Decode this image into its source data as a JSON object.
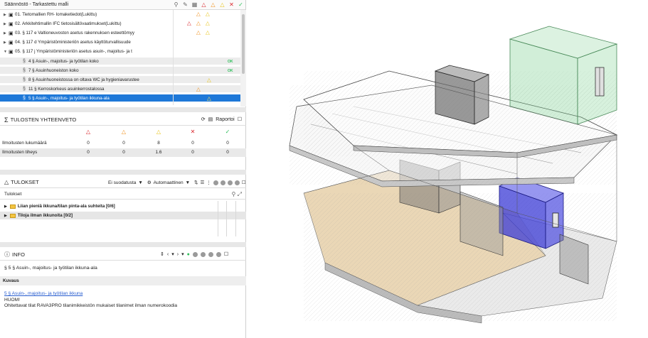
{
  "rules": {
    "title": "Säännöstö - Tarkastettu malli",
    "items": [
      {
        "label": "01. Tietomallien RH- lomaketiedot(Lukittu)",
        "stats": [
          "orange",
          "yellow"
        ]
      },
      {
        "label": "02. Arkkitehtimallin IFC tietosisältövaatimukset(Lukittu)",
        "stats": [
          "red",
          "orange",
          "yellow"
        ]
      },
      {
        "label": "03. § 117 e Valtioneuvoston asetus rakennuksen esteettömyy",
        "stats": [
          "orange",
          "yellow"
        ]
      },
      {
        "label": "04. § 117 d Ympäristöministeriön asetus käyttöturvallisuude",
        "stats": []
      },
      {
        "label": "05. § 117 j Ympäristöministeriön asetus asuin-, majoitus- ja t",
        "stats": []
      },
      {
        "label": "4 § Asuin-, majoitus- ja työtilan koko",
        "stats": [
          "ok"
        ]
      },
      {
        "label": "7 § Asuinhuoneiston koko",
        "stats": [
          "ok"
        ]
      },
      {
        "label": "8 § Asuinhuoneistossa on oltava WC ja hygieniavarustee",
        "stats": [
          "yellow"
        ]
      },
      {
        "label": "11 § Kerroskorkeus asuinkerrostalossa",
        "stats": [
          "orange"
        ]
      },
      {
        "label": "5 § Asuin-, majoitus- ja työtilan ikkuna-ala",
        "stats": [
          "white"
        ]
      }
    ],
    "ok_label": "OK"
  },
  "summary": {
    "title": "TULOSTEN YHTEENVETO",
    "report_label": "Raportoi",
    "rows": [
      {
        "label": "Ilmoitusten lukumäärä",
        "values": [
          "0",
          "0",
          "8",
          "0",
          "0"
        ]
      },
      {
        "label": "Ilmoitusten tiheys",
        "values": [
          "0",
          "0",
          "1.6",
          "0",
          "0"
        ]
      }
    ]
  },
  "results": {
    "title": "TULOKSET",
    "filter_label": "Ei suodatusta",
    "auto_label": "Automaattinen",
    "column_header": "Tulokset",
    "items": [
      {
        "label": "Liian pieniä ikkuna/tilan pinta-ala suhteita [0/6]"
      },
      {
        "label": "Tiloja ilman ikkunoita [0/2]"
      }
    ]
  },
  "info": {
    "title": "INFO",
    "rule_name": "5 § Asuin-, majoitus- ja työtilan ikkuna-ala",
    "section_label": "Kuvaus",
    "link_text": "5 § Asuin-, majoitus- ja työtilan ikkuna",
    "line1": "HUOM!",
    "line2": "Ohitettavat tilat RAVA3PRO tilanimikkeistön mukaiset tilanimet ilman numerokoodia"
  },
  "colors": {
    "selection": "#1e78d8",
    "error": "#d9262c",
    "warning": "#f0901c",
    "notice": "#e8c315",
    "ok": "#2dbf5a",
    "highlight_green": "#7ccf8f",
    "highlight_blue": "#3b3bd6",
    "floor_tan": "#d9b77a"
  }
}
